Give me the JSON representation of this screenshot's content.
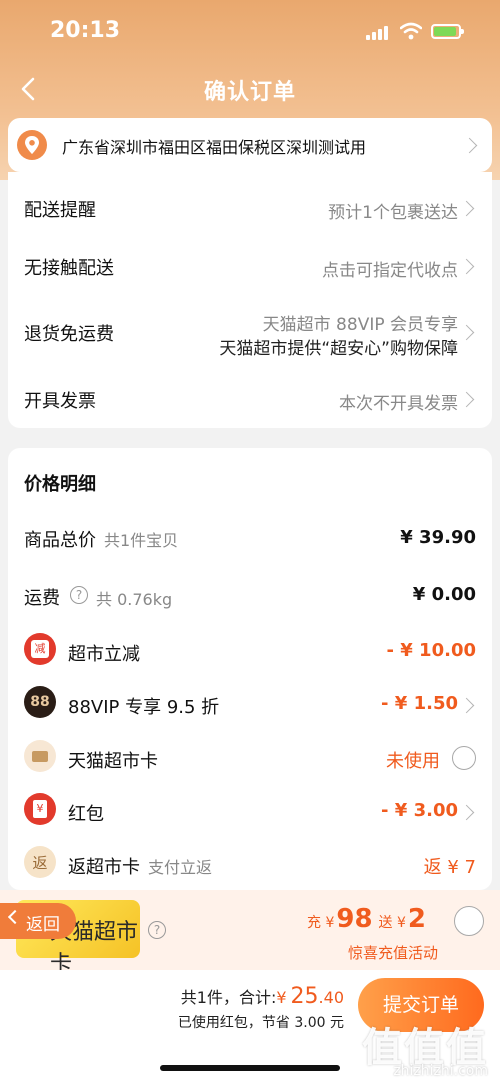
{
  "status": {
    "time": "20:13"
  },
  "nav": {
    "title": "确认订单"
  },
  "address": {
    "text": "广东省深圳市福田区福田保税区深圳测试用"
  },
  "delivery": [
    {
      "label": "配送提醒",
      "value": "预计1个包裹送达"
    },
    {
      "label": "无接触配送",
      "value": "点击可指定代收点"
    },
    {
      "label": "退货免运费",
      "value": "天猫超市 88VIP 会员专享",
      "value2": "天猫超市提供“超安心”购物保障"
    },
    {
      "label": "开具发票",
      "value": "本次不开具发票"
    }
  ],
  "price": {
    "heading": "价格明细",
    "total": {
      "label": "商品总价",
      "sub": "共1件宝贝",
      "amount": "¥ 39.90"
    },
    "shipping": {
      "label": "运费",
      "sub": "共 0.76kg",
      "amount": "¥ 0.00"
    },
    "discounts": [
      {
        "label": "超市立减",
        "amount": "- ¥ 10.00",
        "icon": "减"
      },
      {
        "label": "88VIP 专享 9.5 折",
        "amount": "- ¥ 1.50",
        "icon": "88"
      },
      {
        "label": "天猫超市卡",
        "amount": "未使用"
      },
      {
        "label": "红包",
        "amount": "- ¥ 3.00",
        "icon": "¥"
      },
      {
        "label": "返超市卡",
        "sub": "支付立返",
        "amount": "返 ¥ 7",
        "icon": "返"
      }
    ]
  },
  "promo": {
    "card_text": "天猫超市卡",
    "back_label": "返回",
    "charge_prefix": "充 ¥",
    "charge_amount": "98",
    "gift_prefix": "送 ¥",
    "gift_amount": "2",
    "activity": "惊喜充值活动"
  },
  "bottom": {
    "count": "共1件，",
    "total_label": "合计:",
    "currency": "¥",
    "total_int": "25",
    "total_dec": ".40",
    "saved": "已使用红包，节省 3.00 元",
    "submit": "提交订单"
  },
  "watermark": {
    "text": "值值值",
    "url": "zhizhizhi.com"
  },
  "colors": {
    "accent": "#f05b1e",
    "header": "#eeb07a",
    "button": "#ff7a2a"
  }
}
